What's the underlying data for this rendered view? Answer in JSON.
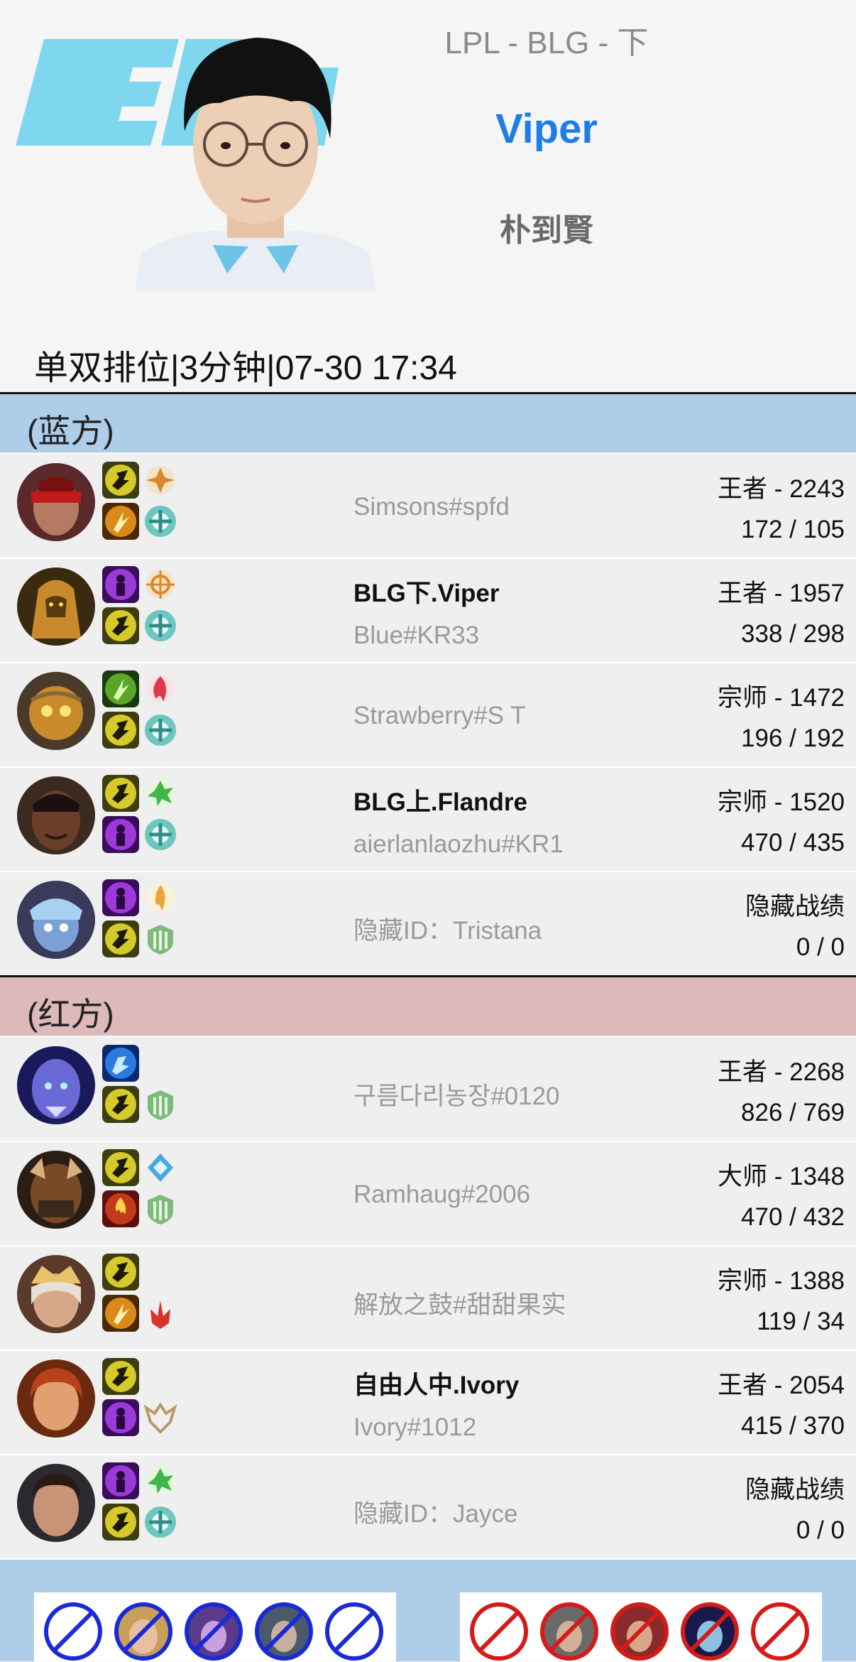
{
  "header": {
    "league_line": "LPL - BLG - 下",
    "player_name": "Viper",
    "real_name": "朴到賢",
    "match_info": "单双排位|3分钟|07-30 17:34",
    "accent_color": "#1e7ee6"
  },
  "blue_team": {
    "label": "(蓝方)",
    "color": "#aecde9",
    "players": [
      {
        "champion_icon": "lee-sin-portrait",
        "name": "",
        "tag": "Simsons#spfd",
        "rank": "王者 - 2243",
        "wl": "172 / 105"
      },
      {
        "champion_icon": "azir-portrait",
        "name": "BLG下.Viper",
        "tag": "Blue#KR33",
        "rank": "王者 - 1957",
        "wl": "338 / 298"
      },
      {
        "champion_icon": "amumu-portrait",
        "name": "",
        "tag": "Strawberry#S T",
        "rank": "宗师 - 1472",
        "wl": "196 / 192"
      },
      {
        "champion_icon": "k-sante-portrait",
        "name": "BLG上.Flandre",
        "tag": "aierlanlaozhu#KR1",
        "rank": "宗师 - 1520",
        "wl": "470 / 435"
      },
      {
        "champion_icon": "tristana-portrait",
        "name": "",
        "tag": "隐藏ID：Tristana",
        "rank": "隐藏战绩",
        "wl": "0 / 0"
      }
    ]
  },
  "red_team": {
    "label": "(红方)",
    "color": "#ddb9b9",
    "players": [
      {
        "champion_icon": "ryze-portrait",
        "name": "",
        "tag": "구름다리농장#0120",
        "rank": "王者 - 2268",
        "wl": "826 / 769"
      },
      {
        "champion_icon": "ornn-portrait",
        "name": "",
        "tag": "Ramhaug#2006",
        "rank": "大师 - 1348",
        "wl": "470 / 432"
      },
      {
        "champion_icon": "taliyah-portrait",
        "name": "",
        "tag": "解放之鼓#甜甜果实",
        "rank": "宗师 - 1388",
        "wl": "119 / 34"
      },
      {
        "champion_icon": "quinn-portrait",
        "name": "自由人中.Ivory",
        "tag": "Ivory#1012",
        "rank": "王者 - 2054",
        "wl": "415 / 370"
      },
      {
        "champion_icon": "jayce-portrait",
        "name": "",
        "tag": "隐藏ID：Jayce",
        "rank": "隐藏战绩",
        "wl": "0 / 0"
      }
    ]
  },
  "bans": {
    "blue": [
      "empty-ban-icon",
      "ezreal-ban-icon",
      "kaisa-ban-icon",
      "sylas-ban-icon",
      "empty-ban-icon"
    ],
    "red": [
      "empty-ban-icon",
      "yasuo-ban-icon",
      "samira-ban-icon",
      "vex-ban-icon",
      "empty-ban-icon"
    ]
  }
}
